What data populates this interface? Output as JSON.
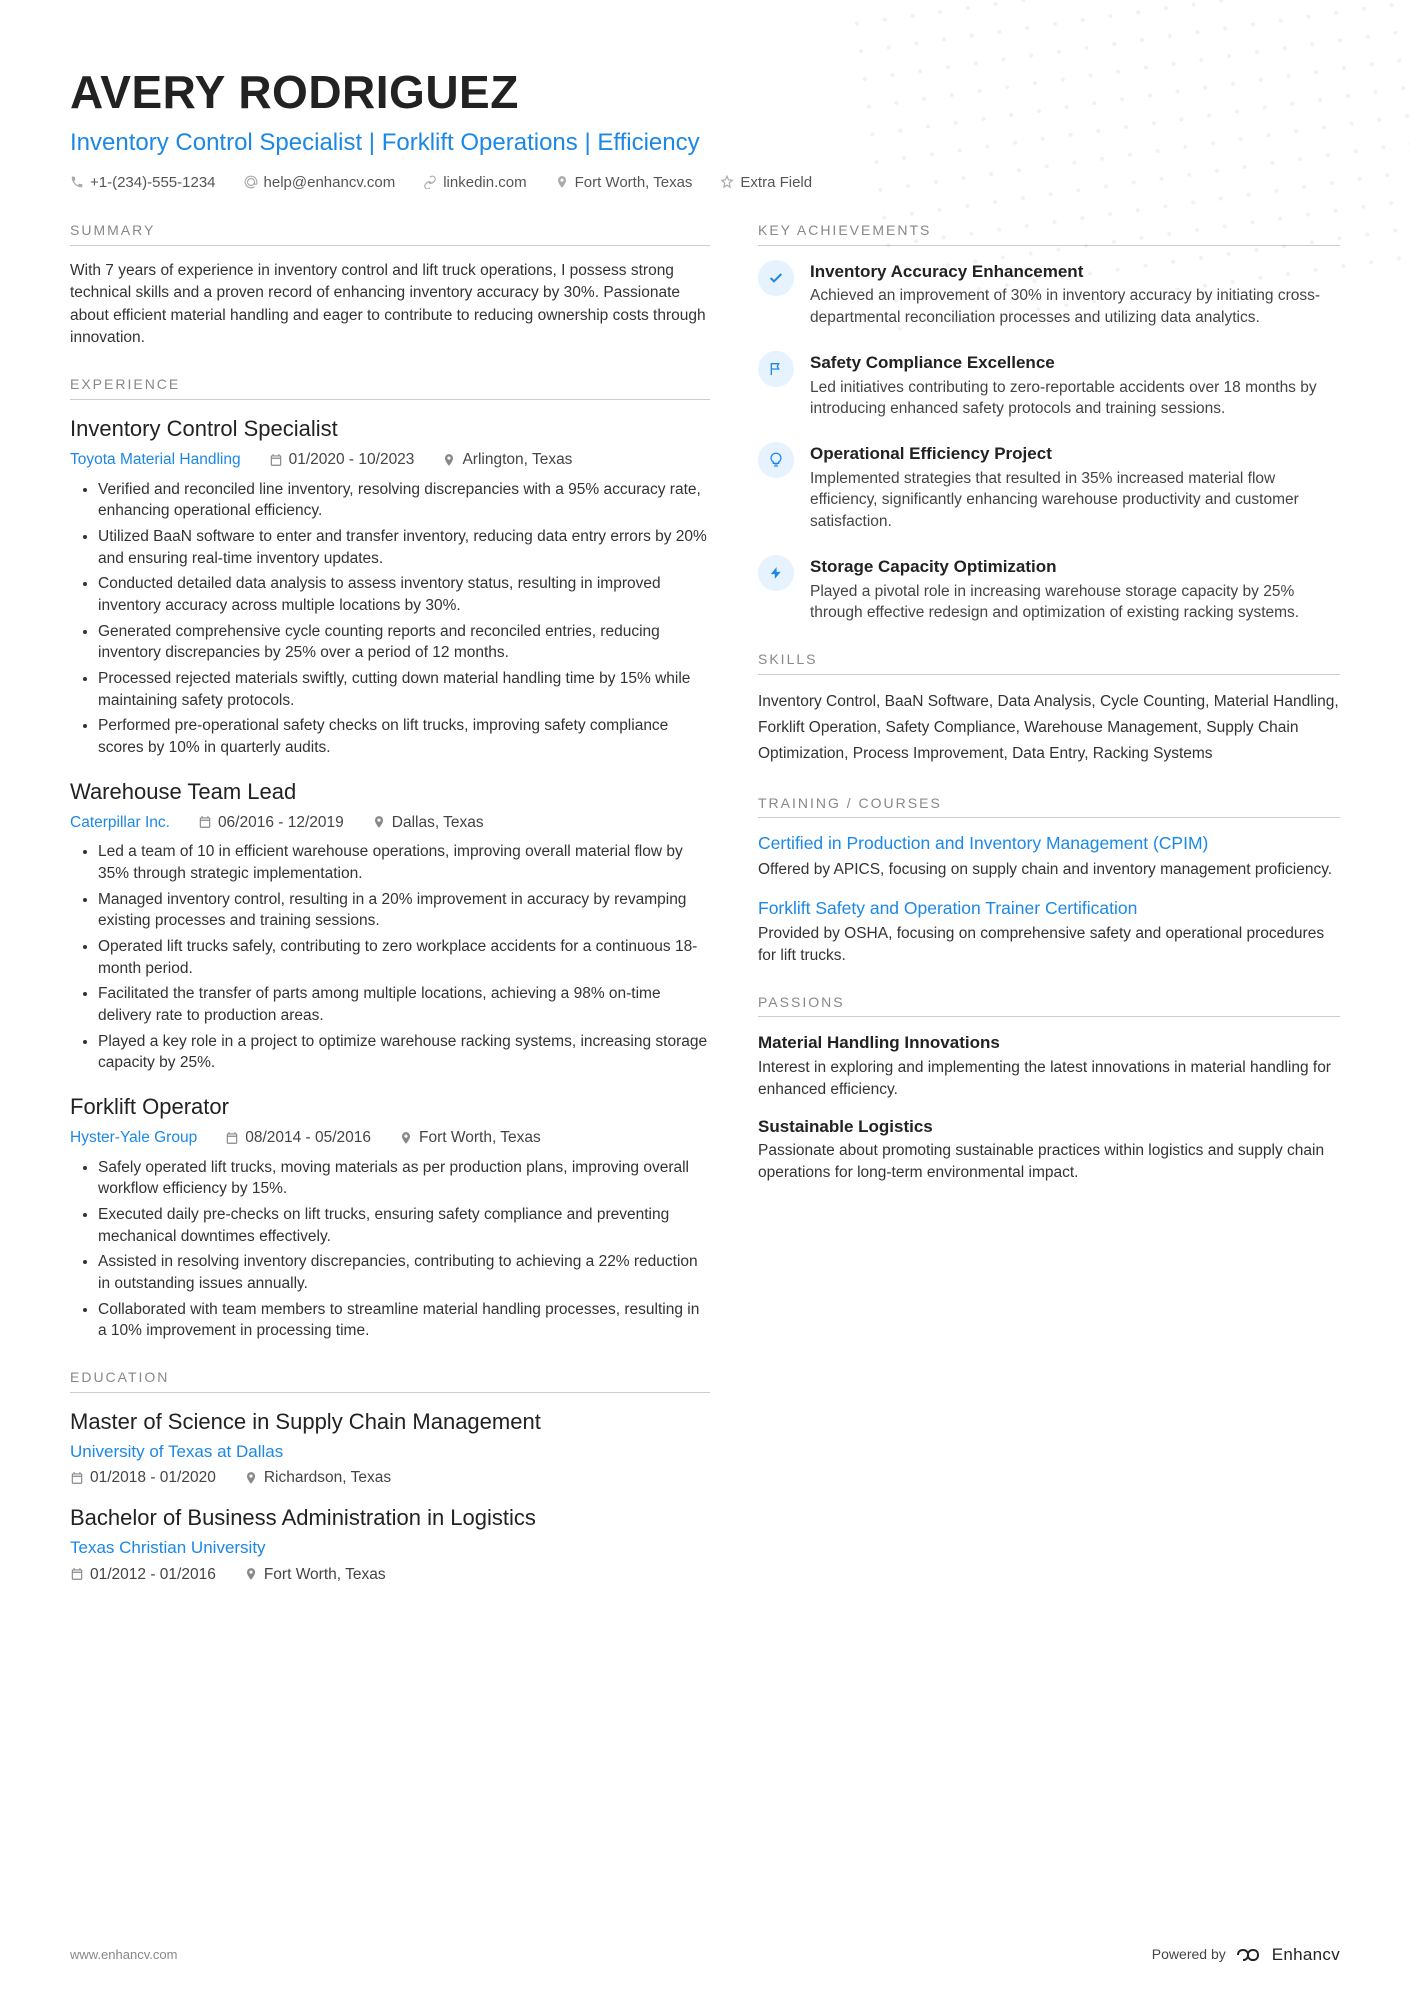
{
  "header": {
    "name": "AVERY RODRIGUEZ",
    "subtitle": "Inventory Control Specialist | Forklift Operations | Efficiency",
    "phone": "+1-(234)-555-1234",
    "email": "help@enhancv.com",
    "linkedin": "linkedin.com",
    "location": "Fort Worth, Texas",
    "extra": "Extra Field"
  },
  "sections": {
    "summary_label": "SUMMARY",
    "experience_label": "EXPERIENCE",
    "education_label": "EDUCATION",
    "achievements_label": "KEY ACHIEVEMENTS",
    "skills_label": "SKILLS",
    "training_label": "TRAINING / COURSES",
    "passions_label": "PASSIONS"
  },
  "summary": "With 7 years of experience in inventory control and lift truck operations, I possess strong technical skills and a proven record of enhancing inventory accuracy by 30%. Passionate about efficient material handling and eager to contribute to reducing ownership costs through innovation.",
  "experience": [
    {
      "title": "Inventory Control Specialist",
      "company": "Toyota Material Handling",
      "dates": "01/2020 - 10/2023",
      "location": "Arlington, Texas",
      "bullets": [
        "Verified and reconciled line inventory, resolving discrepancies with a 95% accuracy rate, enhancing operational efficiency.",
        "Utilized BaaN software to enter and transfer inventory, reducing data entry errors by 20% and ensuring real-time inventory updates.",
        "Conducted detailed data analysis to assess inventory status, resulting in improved inventory accuracy across multiple locations by 30%.",
        "Generated comprehensive cycle counting reports and reconciled entries, reducing inventory discrepancies by 25% over a period of 12 months.",
        "Processed rejected materials swiftly, cutting down material handling time by 15% while maintaining safety protocols.",
        "Performed pre-operational safety checks on lift trucks, improving safety compliance scores by 10% in quarterly audits."
      ]
    },
    {
      "title": "Warehouse Team Lead",
      "company": "Caterpillar Inc.",
      "dates": "06/2016 - 12/2019",
      "location": "Dallas, Texas",
      "bullets": [
        "Led a team of 10 in efficient warehouse operations, improving overall material flow by 35% through strategic implementation.",
        "Managed inventory control, resulting in a 20% improvement in accuracy by revamping existing processes and training sessions.",
        "Operated lift trucks safely, contributing to zero workplace accidents for a continuous 18-month period.",
        "Facilitated the transfer of parts among multiple locations, achieving a 98% on-time delivery rate to production areas.",
        "Played a key role in a project to optimize warehouse racking systems, increasing storage capacity by 25%."
      ]
    },
    {
      "title": "Forklift Operator",
      "company": "Hyster-Yale Group",
      "dates": "08/2014 - 05/2016",
      "location": "Fort Worth, Texas",
      "bullets": [
        "Safely operated lift trucks, moving materials as per production plans, improving overall workflow efficiency by 15%.",
        "Executed daily pre-checks on lift trucks, ensuring safety compliance and preventing mechanical downtimes effectively.",
        "Assisted in resolving inventory discrepancies, contributing to achieving a 22% reduction in outstanding issues annually.",
        "Collaborated with team members to streamline material handling processes, resulting in a 10% improvement in processing time."
      ]
    }
  ],
  "education": [
    {
      "degree": "Master of Science in Supply Chain Management",
      "school": "University of Texas at Dallas",
      "dates": "01/2018 - 01/2020",
      "location": "Richardson, Texas"
    },
    {
      "degree": "Bachelor of Business Administration in Logistics",
      "school": "Texas Christian University",
      "dates": "01/2012 - 01/2016",
      "location": "Fort Worth, Texas"
    }
  ],
  "achievements": [
    {
      "icon": "check",
      "title": "Inventory Accuracy Enhancement",
      "desc": "Achieved an improvement of 30% in inventory accuracy by initiating cross-departmental reconciliation processes and utilizing data analytics."
    },
    {
      "icon": "flag",
      "title": "Safety Compliance Excellence",
      "desc": "Led initiatives contributing to zero-reportable accidents over 18 months by introducing enhanced safety protocols and training sessions."
    },
    {
      "icon": "bulb",
      "title": "Operational Efficiency Project",
      "desc": "Implemented strategies that resulted in 35% increased material flow efficiency, significantly enhancing warehouse productivity and customer satisfaction."
    },
    {
      "icon": "bolt",
      "title": "Storage Capacity Optimization",
      "desc": "Played a pivotal role in increasing warehouse storage capacity by 25% through effective redesign and optimization of existing racking systems."
    }
  ],
  "skills": "Inventory Control, BaaN Software, Data Analysis, Cycle Counting, Material Handling, Forklift Operation, Safety Compliance, Warehouse Management, Supply Chain Optimization, Process Improvement, Data Entry, Racking Systems",
  "training": [
    {
      "title": "Certified in Production and Inventory Management (CPIM)",
      "desc": "Offered by APICS, focusing on supply chain and inventory management proficiency."
    },
    {
      "title": "Forklift Safety and Operation Trainer Certification",
      "desc": "Provided by OSHA, focusing on comprehensive safety and operational procedures for lift trucks."
    }
  ],
  "passions": [
    {
      "title": "Material Handling Innovations",
      "desc": "Interest in exploring and implementing the latest innovations in material handling for enhanced efficiency."
    },
    {
      "title": "Sustainable Logistics",
      "desc": "Passionate about promoting sustainable practices within logistics and supply chain operations for long-term environmental impact."
    }
  ],
  "footer": {
    "url": "www.enhancv.com",
    "powered": "Powered by",
    "brand": "Enhancv"
  }
}
